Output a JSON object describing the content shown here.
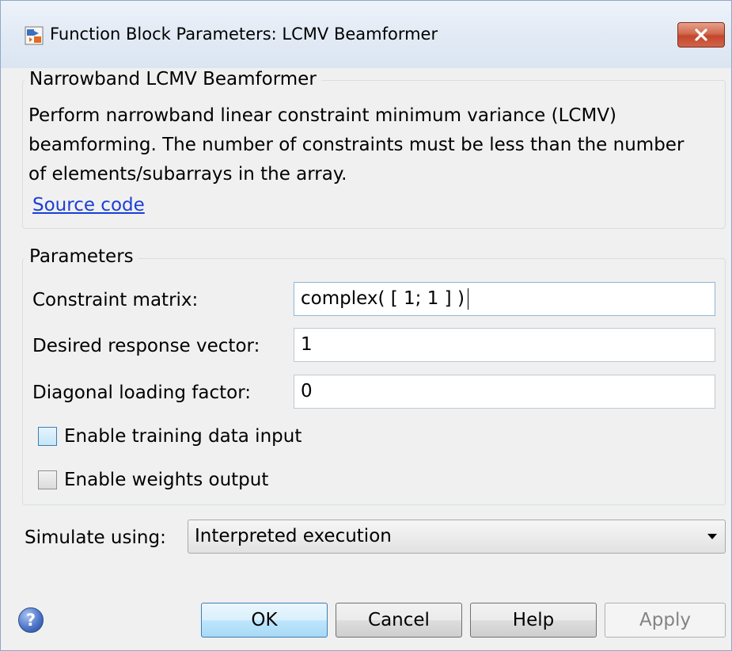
{
  "window": {
    "title": "Function Block Parameters: LCMV Beamformer",
    "close_symbol": "✕"
  },
  "description_group": {
    "title": "Narrowband LCMV Beamformer",
    "text": "Perform narrowband linear constraint minimum variance (LCMV) beamforming. The number of constraints must be less than the number of elements/subarrays in the array.",
    "link": "Source code"
  },
  "parameters": {
    "title": "Parameters",
    "constraint_matrix": {
      "label": "Constraint matrix:",
      "value": "complex( [ 1; 1 ] )"
    },
    "desired_response": {
      "label": "Desired response vector:",
      "value": "1"
    },
    "diagonal_loading": {
      "label": "Diagonal loading factor:",
      "value": "0"
    },
    "enable_training": {
      "label": "Enable training data input",
      "checked": false
    },
    "enable_weights": {
      "label": "Enable weights output",
      "checked": false
    }
  },
  "simulate": {
    "label": "Simulate using:",
    "selected": "Interpreted execution"
  },
  "buttons": {
    "help_icon": "?",
    "ok": "OK",
    "cancel": "Cancel",
    "help": "Help",
    "apply": "Apply"
  },
  "icons": {
    "app": "simulink-block-icon",
    "close": "close-icon",
    "help": "help-icon",
    "dropdown": "chevron-down-icon"
  }
}
